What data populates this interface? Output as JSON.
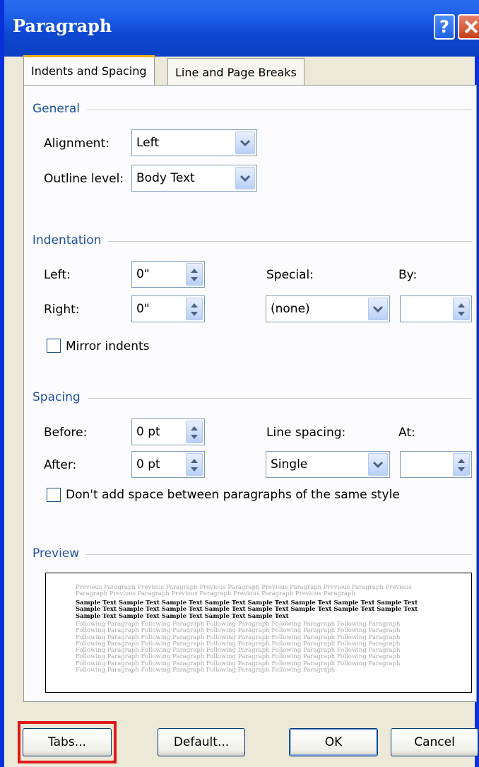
{
  "dialog": {
    "title": "Paragraph",
    "help_glyph": "?"
  },
  "tabs": [
    {
      "label": "Indents and Spacing",
      "active": true
    },
    {
      "label": "Line and Page Breaks",
      "active": false
    }
  ],
  "general": {
    "title": "General",
    "alignment_label": "Alignment:",
    "alignment_value": "Left",
    "outline_label": "Outline level:",
    "outline_value": "Body Text"
  },
  "indentation": {
    "title": "Indentation",
    "left_label": "Left:",
    "left_value": "0\"",
    "right_label": "Right:",
    "right_value": "0\"",
    "special_label": "Special:",
    "special_value": "(none)",
    "by_label": "By:",
    "by_value": "",
    "mirror_label": "Mirror indents"
  },
  "spacing": {
    "title": "Spacing",
    "before_label": "Before:",
    "before_value": "0 pt",
    "after_label": "After:",
    "after_value": "0 pt",
    "line_spacing_label": "Line spacing:",
    "line_spacing_value": "Single",
    "at_label": "At:",
    "at_value": "",
    "dont_add_label": "Don't add space between paragraphs of the same style"
  },
  "preview": {
    "title": "Preview",
    "previous_text": "Previous Paragraph Previous Paragraph Previous Paragraph Previous Paragraph Previous Paragraph Previous Paragraph Previous Paragraph Previous Paragraph Previous Paragraph Previous Paragraph",
    "sample_text": "Sample Text Sample Text Sample Text Sample Text Sample Text Sample Text Sample Text Sample Text Sample Text Sample Text Sample Text Sample Text Sample Text Sample Text Sample Text Sample Text Sample Text Sample Text Sample Text Sample Text Sample Text",
    "following_text": "Following Paragraph Following Paragraph Following Paragraph Following Paragraph Following Paragraph Following Paragraph Following Paragraph Following Paragraph Following Paragraph Following Paragraph Following Paragraph Following Paragraph Following Paragraph Following Paragraph Following Paragraph Following Paragraph Following Paragraph Following Paragraph Following Paragraph Following Paragraph Following Paragraph Following Paragraph Following Paragraph Following Paragraph Following Paragraph Following Paragraph Following Paragraph Following Paragraph Following Paragraph Following Paragraph Following Paragraph Following Paragraph Following Paragraph Following Paragraph Following Paragraph Following Paragraph Following Paragraph Following Paragraph Following Paragraph"
  },
  "buttons": {
    "tabs": "Tabs...",
    "default": "Default...",
    "ok": "OK",
    "cancel": "Cancel"
  },
  "colors": {
    "title_bar": "#0a3fc2",
    "section_title": "#1f4fa0",
    "highlight": "#e01818"
  }
}
